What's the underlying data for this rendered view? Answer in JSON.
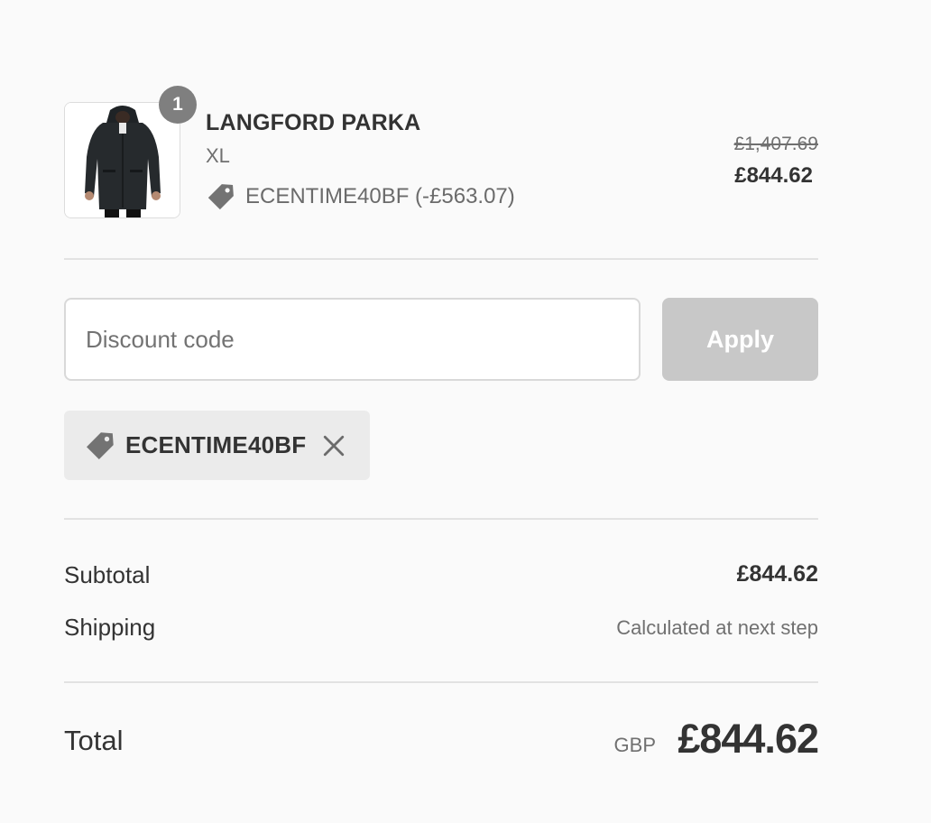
{
  "product": {
    "quantity": "1",
    "name": "LANGFORD PARKA",
    "variant": "XL",
    "discount_applied": "ECENTIME40BF (-£563.07)",
    "original_price": "£1,407.69",
    "final_price": "£844.62"
  },
  "discount_form": {
    "placeholder": "Discount code",
    "value": "",
    "apply_label": "Apply"
  },
  "applied_code": {
    "code": "ECENTIME40BF"
  },
  "summary": {
    "subtotal_label": "Subtotal",
    "subtotal_value": "£844.62",
    "shipping_label": "Shipping",
    "shipping_value": "Calculated at next step",
    "total_label": "Total",
    "currency": "GBP",
    "total_value": "£844.62"
  },
  "colors": {
    "background": "#fafafa",
    "apply_disabled": "#c8c8c8",
    "chip_bg": "#ebebeb",
    "badge_bg": "#7f7f7f",
    "tag_icon": "#737373"
  },
  "icons": {
    "tag": "tag-icon",
    "remove": "close-icon"
  }
}
